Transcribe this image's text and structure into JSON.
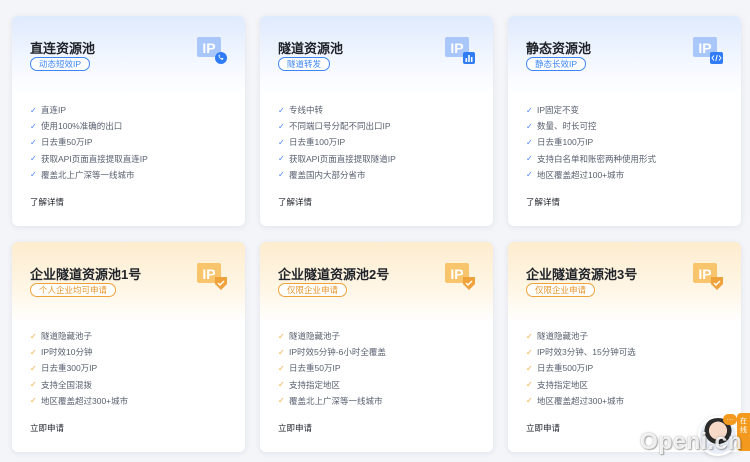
{
  "cards": [
    {
      "title": "直连资源池",
      "badge": "动态短效IP",
      "icon": "ip-phone-icon",
      "features": [
        "直连IP",
        "使用100%准确的出口",
        "日去重50万IP",
        "获取API页面直接提取直连IP",
        "覆盖北上广深等一线城市"
      ],
      "link": "了解详情"
    },
    {
      "title": "隧道资源池",
      "badge": "隧道转发",
      "icon": "ip-chart-icon",
      "features": [
        "专线中转",
        "不同端口号分配不同出口IP",
        "日去重100万IP",
        "获取API页面直接提取隧道IP",
        "覆盖国内大部分省市"
      ],
      "link": "了解详情"
    },
    {
      "title": "静态资源池",
      "badge": "静态长效IP",
      "icon": "ip-code-icon",
      "features": [
        "IP固定不变",
        "数量、时长可控",
        "日去重100万IP",
        "支持白名单和账密两种使用形式",
        "地区覆盖超过100+城市"
      ],
      "link": "了解详情"
    },
    {
      "title": "企业隧道资源池1号",
      "badge": "个人企业均可申请",
      "icon": "ip-check-icon",
      "features": [
        "隧道隐藏池子",
        "IP时效10分钟",
        "日去重300万IP",
        "支持全国混拨",
        "地区覆盖超过300+城市"
      ],
      "link": "立即申请"
    },
    {
      "title": "企业隧道资源池2号",
      "badge": "仅限企业申请",
      "icon": "ip-check-icon",
      "features": [
        "隧道隐藏池子",
        "IP时效5分钟-6小时全覆盖",
        "日去重50万IP",
        "支持指定地区",
        "覆盖北上广深等一线城市"
      ],
      "link": "立即申请"
    },
    {
      "title": "企业隧道资源池3号",
      "badge": "仅限企业申请",
      "icon": "ip-check-icon",
      "features": [
        "隧道隐藏池子",
        "IP时效3分钟、15分钟可选",
        "日去重500万IP",
        "支持指定地区",
        "地区覆盖超过300+城市"
      ],
      "link": "立即申请"
    }
  ],
  "colors": {
    "blue": "#3e86f5",
    "orange": "#f0a23a"
  },
  "side": {
    "bubble": "…",
    "tab": "在线"
  },
  "watermark": "Openi.cn"
}
